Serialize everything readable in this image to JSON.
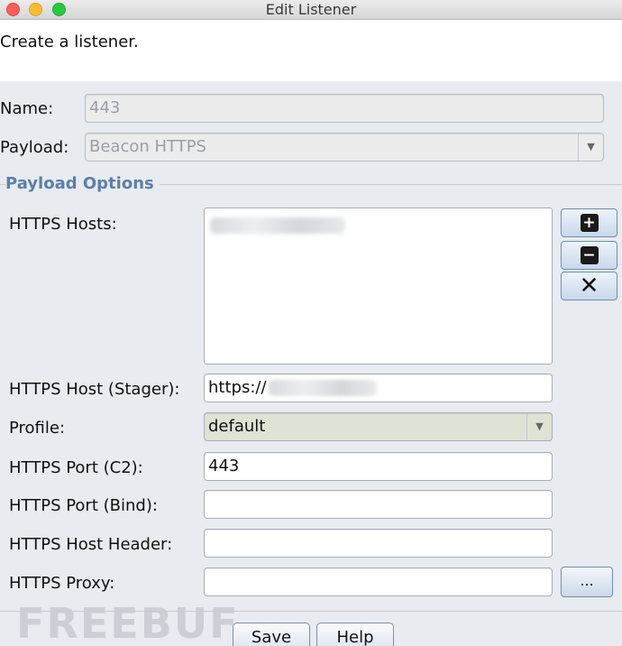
{
  "window": {
    "title": "Edit Listener"
  },
  "header": {
    "text": "Create a listener."
  },
  "form": {
    "name_label": "Name:",
    "name_value": "443",
    "payload_label": "Payload:",
    "payload_value": "Beacon HTTPS"
  },
  "options": {
    "group_title": "Payload Options",
    "hosts_label": "HTTPS Hosts:",
    "stager_label": "HTTPS Host (Stager):",
    "stager_value": "https://",
    "profile_label": "Profile:",
    "profile_value": "default",
    "port_c2_label": "HTTPS Port (C2):",
    "port_c2_value": "443",
    "port_bind_label": "HTTPS Port (Bind):",
    "port_bind_value": "",
    "host_header_label": "HTTPS Host Header:",
    "host_header_value": "",
    "proxy_label": "HTTPS Proxy:",
    "proxy_value": "",
    "proxy_button": "..."
  },
  "watermark": "FREEBUF",
  "buttons": {
    "save": "Save",
    "help": "Help"
  },
  "icons": {
    "add": "plus-icon",
    "remove": "minus-icon",
    "clear": "x-icon",
    "dropdown": "chevron-down-icon"
  },
  "colors": {
    "group_title": "#5b7fa8",
    "close": "#fc5f57",
    "minimize": "#fdbc2e",
    "zoom": "#29c940"
  }
}
